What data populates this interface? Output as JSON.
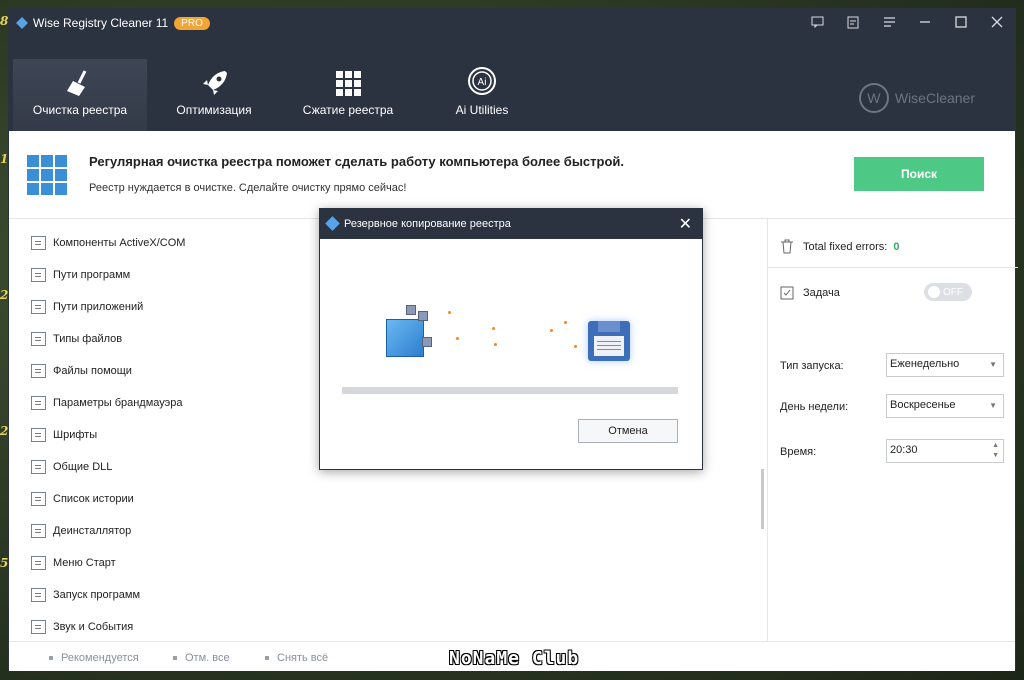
{
  "app": {
    "title": "Wise Registry Cleaner 11",
    "badge": "PRO",
    "brand": "WiseCleaner",
    "brand_initial": "W"
  },
  "nav": {
    "tabs": [
      {
        "label": "Очистка реестра",
        "icon": "broom-icon",
        "active": true
      },
      {
        "label": "Оптимизация",
        "icon": "rocket-icon",
        "active": false
      },
      {
        "label": "Сжатие реестра",
        "icon": "grid-icon",
        "active": false
      },
      {
        "label": "Ai Utilities",
        "icon": "ai-icon",
        "active": false
      }
    ]
  },
  "banner": {
    "title": "Регулярная очистка реестра поможет сделать работу компьютера более быстрой.",
    "subtitle": "Реестр нуждается в очистке. Сделайте очистку прямо сейчас!",
    "scan_button": "Поиск"
  },
  "categories": [
    "Компоненты ActiveX/COM",
    "Пути программ",
    "Пути приложений",
    "Типы файлов",
    "Файлы помощи",
    "Параметры брандмауэра",
    "Шрифты",
    "Общие DLL",
    "Список истории",
    "Деинсталлятор",
    "Меню Старт",
    "Запуск программ",
    "Звук и События"
  ],
  "right_panel": {
    "fixed_label": "Total fixed errors:",
    "fixed_count": "0",
    "task_label": "Задача",
    "toggle_state": "OFF",
    "launch_type_label": "Тип запуска:",
    "launch_type_value": "Еженедельно",
    "weekday_label": "День недели:",
    "weekday_value": "Воскресенье",
    "time_label": "Время:",
    "time_value": "20:30"
  },
  "footer": {
    "recommended": "Рекомендуется",
    "select_all": "Отм. все",
    "deselect_all": "Снять всё",
    "watermark": "NoNaMe Club"
  },
  "dialog": {
    "title": "Резервное копирование реестра",
    "cancel": "Отмена",
    "progress": 0
  },
  "desktop_marks": [
    "8",
    "1",
    "2",
    "2",
    "5"
  ],
  "colors": {
    "titlebar": "#2b3240",
    "accent_green": "#4ec985",
    "accent_blue": "#3a8fd8",
    "pro_badge": "#f2a534"
  }
}
